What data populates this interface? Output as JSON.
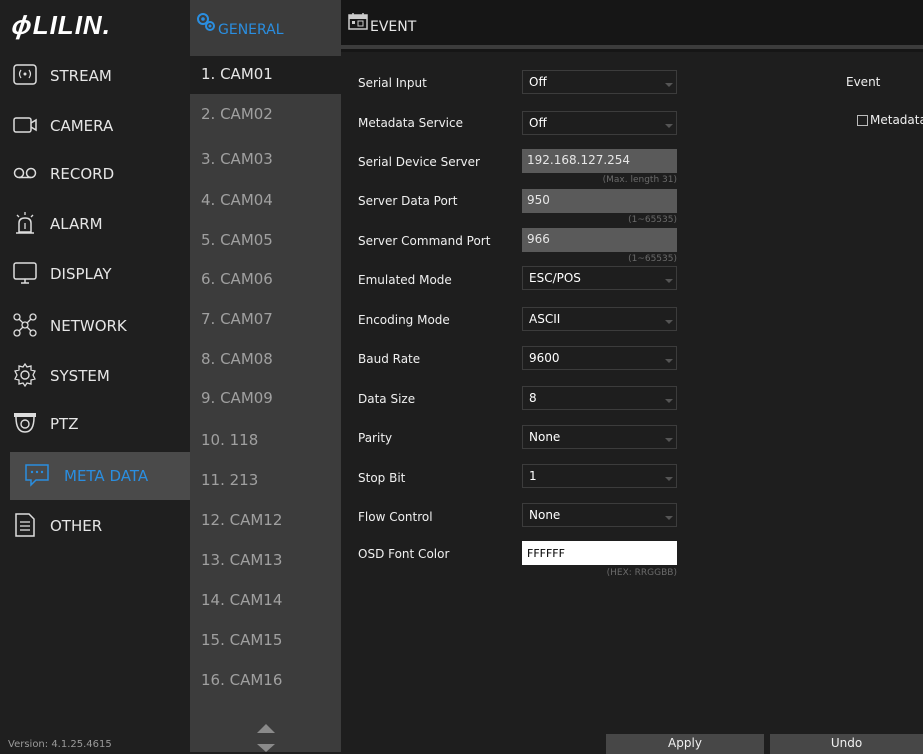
{
  "brand": {
    "logo_text": "LILIN"
  },
  "sidebar": {
    "items": [
      {
        "label": "STREAM",
        "icon": "stream-icon"
      },
      {
        "label": "CAMERA",
        "icon": "camera-icon"
      },
      {
        "label": "RECORD",
        "icon": "record-icon"
      },
      {
        "label": "ALARM",
        "icon": "alarm-icon"
      },
      {
        "label": "DISPLAY",
        "icon": "display-icon"
      },
      {
        "label": "NETWORK",
        "icon": "network-icon"
      },
      {
        "label": "SYSTEM",
        "icon": "system-gear-icon"
      },
      {
        "label": "PTZ",
        "icon": "ptz-camera-icon"
      },
      {
        "label": "META DATA",
        "icon": "chat-bubble-icon",
        "active": true
      },
      {
        "label": "OTHER",
        "icon": "document-icon"
      }
    ],
    "version": "Version: 4.1.25.4615"
  },
  "tabs": {
    "general": {
      "label": "GENERAL",
      "icon": "gears-icon",
      "active": true
    },
    "event": {
      "label": "EVENT",
      "icon": "calendar-icon"
    }
  },
  "cameras": [
    "1. CAM01",
    "2. CAM02",
    "3. CAM03",
    "4. CAM04",
    "5. CAM05",
    "6. CAM06",
    "7. CAM07",
    "8. CAM08",
    "9. CAM09",
    "10. 118",
    "11. 213",
    "12. CAM12",
    "13. CAM13",
    "14. CAM14",
    "15. CAM15",
    "16. CAM16"
  ],
  "form": {
    "serial_input": {
      "label": "Serial Input",
      "value": "Off"
    },
    "metadata_service": {
      "label": "Metadata Service",
      "value": "Off"
    },
    "serial_device_server": {
      "label": "Serial Device Server",
      "value": "192.168.127.254",
      "hint": "(Max. length 31)"
    },
    "server_data_port": {
      "label": "Server Data Port",
      "value": "950",
      "hint": "(1~65535)"
    },
    "server_command_port": {
      "label": "Server Command Port",
      "value": "966",
      "hint": "(1~65535)"
    },
    "emulated_mode": {
      "label": "Emulated Mode",
      "value": "ESC/POS"
    },
    "encoding_mode": {
      "label": "Encoding Mode",
      "value": "ASCII"
    },
    "baud_rate": {
      "label": "Baud Rate",
      "value": "9600"
    },
    "data_size": {
      "label": "Data Size",
      "value": "8"
    },
    "parity": {
      "label": "Parity",
      "value": "None"
    },
    "stop_bit": {
      "label": "Stop Bit",
      "value": "1"
    },
    "flow_control": {
      "label": "Flow Control",
      "value": "None"
    },
    "osd_font_color": {
      "label": "OSD Font Color",
      "value": "FFFFFF",
      "hint": "(HEX: RRGGBB)"
    }
  },
  "event_panel": {
    "label": "Event",
    "metadata_checkbox_label": "Metadata",
    "metadata_checked": false
  },
  "buttons": {
    "apply": "Apply",
    "undo": "Undo"
  },
  "colors": {
    "accent": "#2a8ee0",
    "background": "#1e1e1e",
    "panel": "#3c3c3c"
  }
}
